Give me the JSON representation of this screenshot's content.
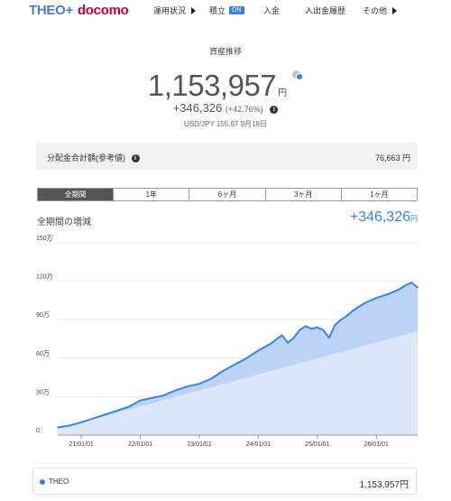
{
  "header": {
    "logo_theo": "THEO+",
    "logo_docomo": "docomo",
    "nav": [
      {
        "label": "運用状況",
        "arrow": true
      },
      {
        "label": "積立",
        "badge": "ON"
      },
      {
        "label": "入金"
      },
      {
        "label": "入出金履歴"
      },
      {
        "label": "その他",
        "arrow": true
      }
    ]
  },
  "summary": {
    "title": "資産推移",
    "total": "1,153,957",
    "total_unit": "円",
    "gain": "+346,326",
    "gain_pct": "(+42.76%)",
    "fx": "USD/JPY 155.97 9月18日"
  },
  "dividend": {
    "label": "分配金合計額(参考値)",
    "value": "76,663 円"
  },
  "tabs": [
    "全期間",
    "1年",
    "6ヶ月",
    "3ヶ月",
    "1ヶ月"
  ],
  "active_tab": 0,
  "chart_header": {
    "title": "全期間の増減",
    "gain": "+346,326",
    "unit": "円"
  },
  "legend": {
    "name": "THEO",
    "value": "1,153,957円"
  },
  "colors": {
    "accent": "#3b82e6",
    "value_fill": "#bcd3f7",
    "deposit_fill": "#dbe7f9",
    "docomo_red": "#cc0033"
  },
  "chart_data": {
    "type": "area",
    "unit": "万",
    "y_ticks": [
      "150万",
      "120万",
      "90万",
      "60万",
      "30万",
      "0"
    ],
    "y_tick_values": [
      150,
      120,
      90,
      60,
      30,
      0
    ],
    "ylim": [
      0,
      150
    ],
    "x_ticks": [
      "21/01/01",
      "22/01/01",
      "23/01/01",
      "24/01/01",
      "25/01/01",
      "26/01/01"
    ],
    "x_tick_values": [
      2021.0,
      2022.0,
      2023.0,
      2024.0,
      2025.0,
      2026.0
    ],
    "xlim": [
      2020.6,
      2026.7
    ],
    "series": [
      {
        "name": "THEO",
        "role": "value",
        "x": [
          2020.6,
          2020.8,
          2021.0,
          2021.2,
          2021.4,
          2021.6,
          2021.8,
          2022.0,
          2022.2,
          2022.4,
          2022.6,
          2022.8,
          2023.0,
          2023.2,
          2023.4,
          2023.6,
          2023.8,
          2024.0,
          2024.2,
          2024.4,
          2024.5,
          2024.6,
          2024.7,
          2024.8,
          2024.9,
          2025.0,
          2025.1,
          2025.2,
          2025.3,
          2025.4,
          2025.5,
          2025.6,
          2025.8,
          2026.0,
          2026.2,
          2026.4,
          2026.5,
          2026.6,
          2026.7
        ],
        "values": [
          6,
          7.5,
          10,
          13,
          16,
          19,
          22,
          27,
          29,
          31,
          35,
          38,
          40,
          44,
          50,
          55,
          60,
          66,
          71,
          78,
          72,
          76,
          82,
          85,
          83,
          84,
          82,
          76,
          86,
          90,
          93,
          97,
          103,
          107,
          110,
          114,
          117,
          119,
          115
        ]
      },
      {
        "name": "",
        "role": "deposit",
        "x": [
          2020.6,
          2026.7
        ],
        "values": [
          5,
          81
        ]
      }
    ],
    "grid": true
  }
}
